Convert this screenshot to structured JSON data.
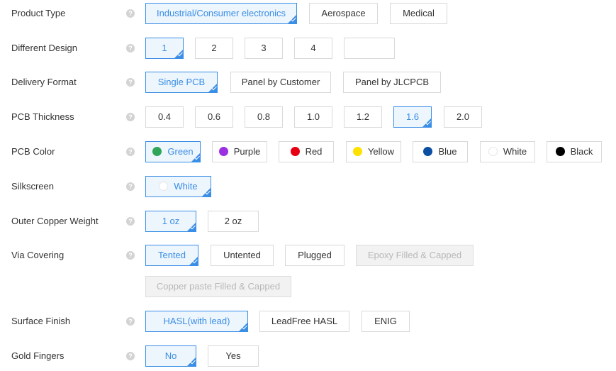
{
  "help_glyph": "?",
  "rows": {
    "product_type": {
      "label": "Product Type",
      "options": [
        "Industrial/Consumer electronics",
        "Aerospace",
        "Medical"
      ],
      "selected": "Industrial/Consumer electronics"
    },
    "different_design": {
      "label": "Different Design",
      "options": [
        "1",
        "2",
        "3",
        "4",
        ""
      ],
      "selected": "1"
    },
    "delivery_format": {
      "label": "Delivery Format",
      "options": [
        "Single PCB",
        "Panel by Customer",
        "Panel by JLCPCB"
      ],
      "selected": "Single PCB"
    },
    "pcb_thickness": {
      "label": "PCB Thickness",
      "options": [
        "0.4",
        "0.6",
        "0.8",
        "1.0",
        "1.2",
        "1.6",
        "2.0"
      ],
      "selected": "1.6"
    },
    "pcb_color": {
      "label": "PCB Color",
      "options": [
        {
          "label": "Green",
          "color": "#2fa55a"
        },
        {
          "label": "Purple",
          "color": "#9b30e0"
        },
        {
          "label": "Red",
          "color": "#e60012"
        },
        {
          "label": "Yellow",
          "color": "#ffe100"
        },
        {
          "label": "Blue",
          "color": "#0b4ea2"
        },
        {
          "label": "White",
          "color": "#ffffff"
        },
        {
          "label": "Black",
          "color": "#000000"
        }
      ],
      "selected": "Green"
    },
    "silkscreen": {
      "label": "Silkscreen",
      "options": [
        {
          "label": "White",
          "color": "#ffffff"
        }
      ],
      "selected": "White"
    },
    "outer_copper_weight": {
      "label": "Outer Copper Weight",
      "options": [
        "1 oz",
        "2 oz"
      ],
      "selected": "1 oz"
    },
    "via_covering": {
      "label": "Via Covering",
      "options": [
        "Tented",
        "Untented",
        "Plugged",
        "Epoxy Filled & Capped",
        "Copper paste Filled & Capped"
      ],
      "selected": "Tented",
      "disabled": [
        "Epoxy Filled & Capped",
        "Copper paste Filled & Capped"
      ]
    },
    "surface_finish": {
      "label": "Surface Finish",
      "options": [
        "HASL(with lead)",
        "LeadFree HASL",
        "ENIG"
      ],
      "selected": "HASL(with lead)"
    },
    "gold_fingers": {
      "label": "Gold Fingers",
      "options": [
        "No",
        "Yes"
      ],
      "selected": "No"
    }
  }
}
